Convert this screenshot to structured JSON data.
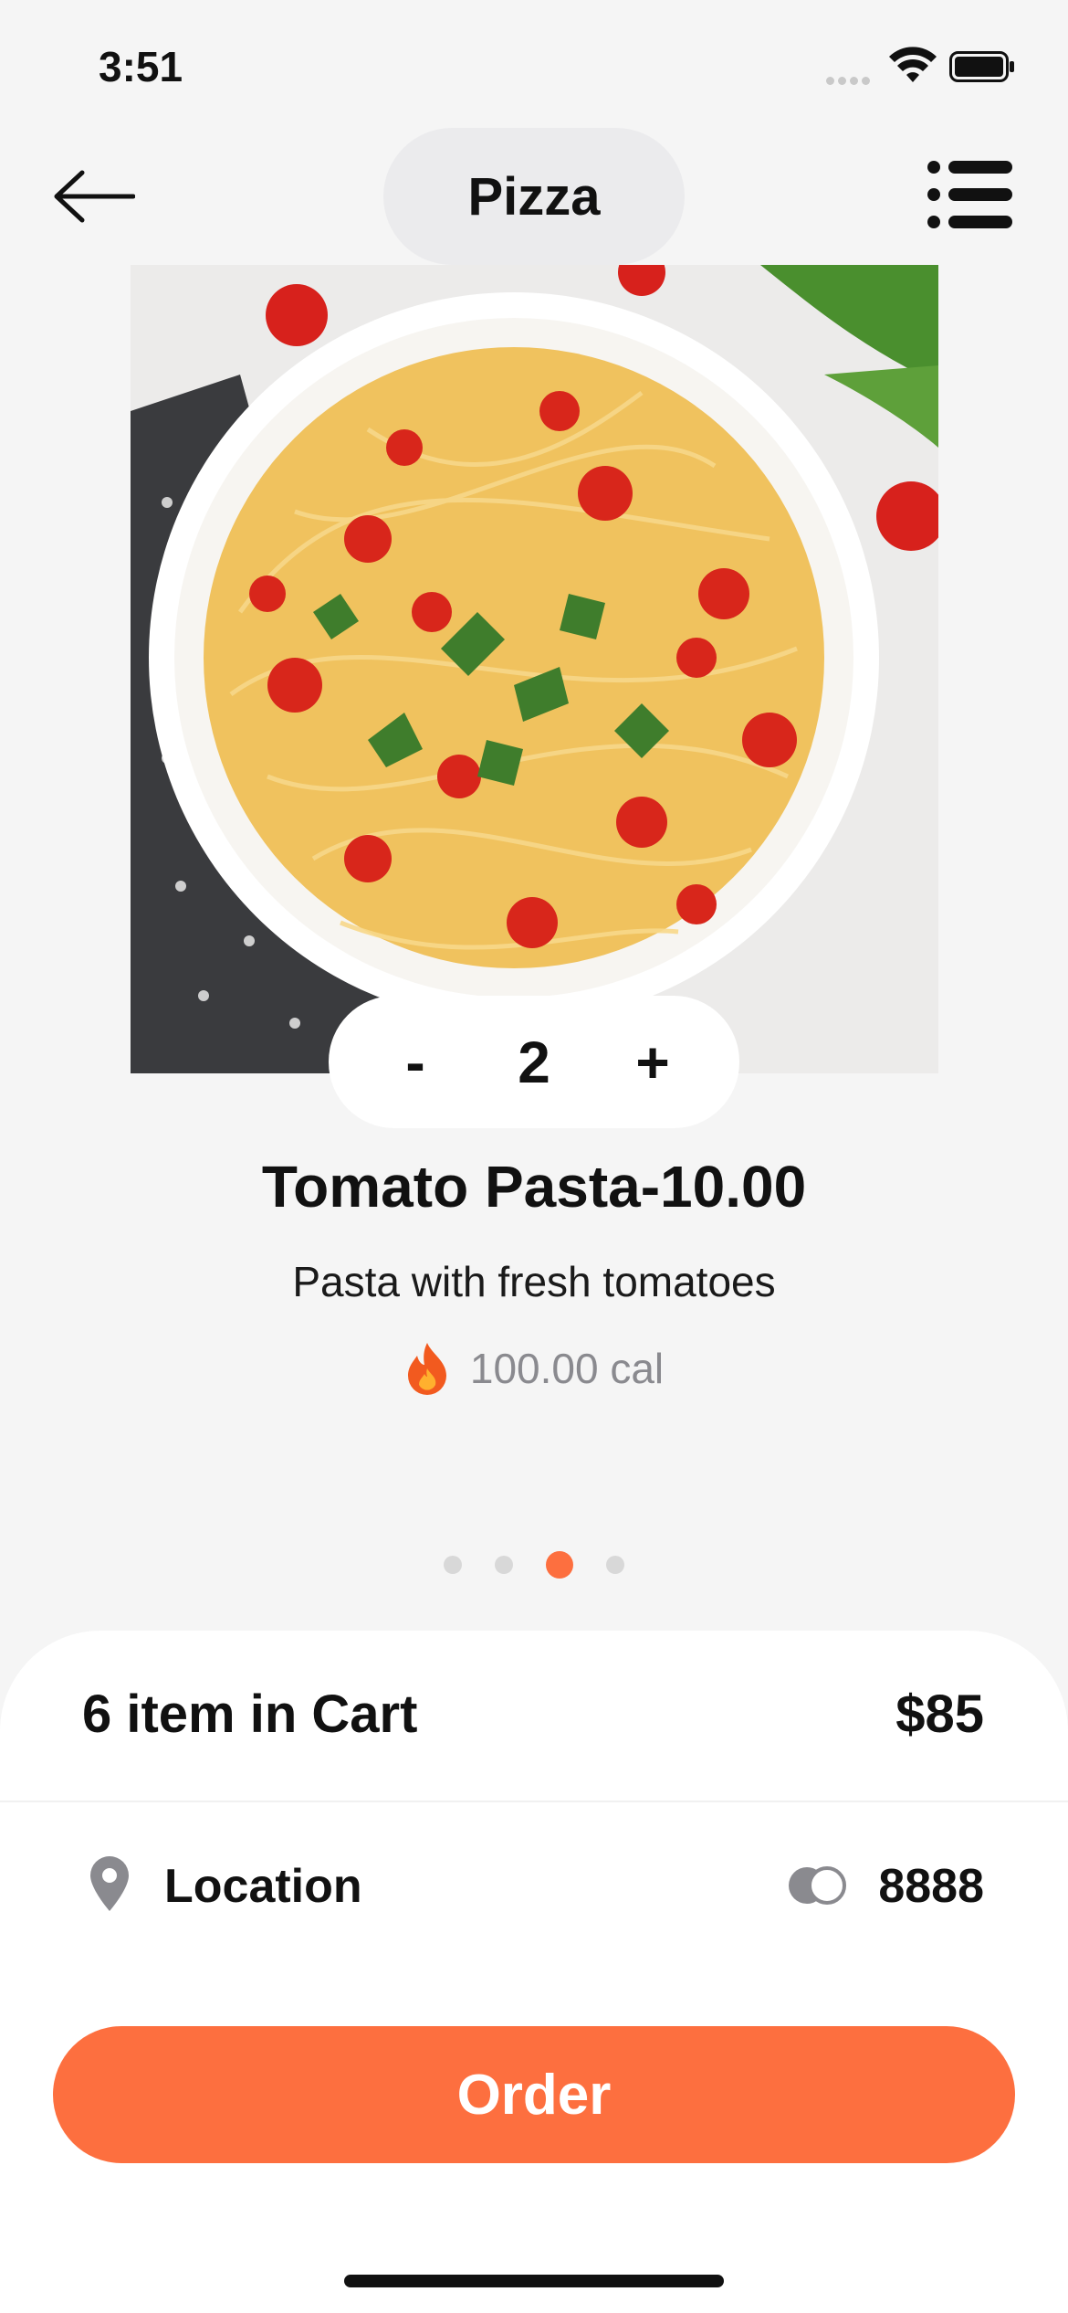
{
  "status_bar": {
    "time": "3:51"
  },
  "header": {
    "title": "Pizza",
    "back_icon": "arrow-left-icon",
    "menu_icon": "list-icon"
  },
  "product": {
    "image_icon": "pasta-photo",
    "quantity": "2",
    "decrement_label": "-",
    "increment_label": "+",
    "name": "Tomato Pasta-10.00",
    "description": "Pasta with fresh tomatoes",
    "calories": "100.00 cal",
    "calories_icon": "flame-icon"
  },
  "carousel": {
    "page_count": 4,
    "active_index": 2
  },
  "cart": {
    "summary": "6 item in Cart",
    "total": "$85",
    "location_label": "Location",
    "points": "8888",
    "order_label": "Order"
  },
  "colors": {
    "accent": "#fd6f3f",
    "background": "#f5f5f5",
    "pill": "#ebebed"
  }
}
